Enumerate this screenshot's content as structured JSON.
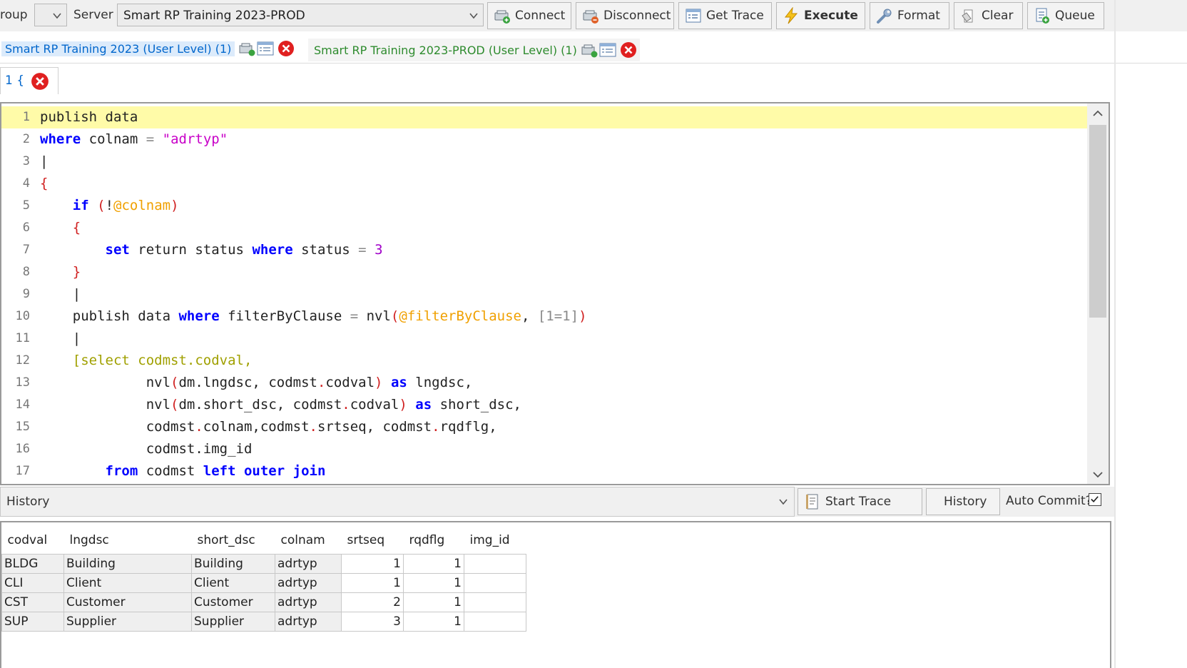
{
  "toolbar": {
    "group_label": "roup",
    "server_label": "Server",
    "server_value": "Smart RP Training 2023-PROD",
    "buttons": {
      "connect": "Connect",
      "disconnect": "Disconnect",
      "get_trace": "Get Trace",
      "execute": "Execute",
      "format": "Format",
      "clear": "Clear",
      "queue": "Queue"
    }
  },
  "connection_tabs": [
    {
      "label": "Smart RP Training 2023 (User Level) (1)"
    },
    {
      "label": "Smart RP Training 2023-PROD (User Level) (1)"
    }
  ],
  "query_tab": {
    "label": "1 {"
  },
  "editor": {
    "line_numbers": [
      "1",
      "2",
      "3",
      "4",
      "5",
      "6",
      "7",
      "8",
      "9",
      "10",
      "11",
      "12",
      "13",
      "14",
      "15",
      "16",
      "17"
    ],
    "current_line": 1,
    "lines": [
      [
        {
          "t": "publish data",
          "c": "plain"
        }
      ],
      [
        {
          "t": "where",
          "c": "kw"
        },
        {
          "t": " colnam ",
          "c": "plain"
        },
        {
          "t": "=",
          "c": "op"
        },
        {
          "t": " ",
          "c": "plain"
        },
        {
          "t": "\"adrtyp\"",
          "c": "str"
        }
      ],
      [
        {
          "t": "|",
          "c": "plain"
        }
      ],
      [
        {
          "t": "{",
          "c": "punc"
        }
      ],
      [
        {
          "t": "    ",
          "c": "plain"
        },
        {
          "t": "if",
          "c": "kw"
        },
        {
          "t": " ",
          "c": "plain"
        },
        {
          "t": "(",
          "c": "punc"
        },
        {
          "t": "!",
          "c": "plain"
        },
        {
          "t": "@colnam",
          "c": "var"
        },
        {
          "t": ")",
          "c": "punc"
        }
      ],
      [
        {
          "t": "    ",
          "c": "plain"
        },
        {
          "t": "{",
          "c": "punc"
        }
      ],
      [
        {
          "t": "        ",
          "c": "plain"
        },
        {
          "t": "set",
          "c": "kw"
        },
        {
          "t": " return status ",
          "c": "plain"
        },
        {
          "t": "where",
          "c": "kw"
        },
        {
          "t": " status ",
          "c": "plain"
        },
        {
          "t": "=",
          "c": "op"
        },
        {
          "t": " ",
          "c": "plain"
        },
        {
          "t": "3",
          "c": "num"
        }
      ],
      [
        {
          "t": "    ",
          "c": "plain"
        },
        {
          "t": "}",
          "c": "punc"
        }
      ],
      [
        {
          "t": "    |",
          "c": "plain"
        }
      ],
      [
        {
          "t": "    publish data ",
          "c": "plain"
        },
        {
          "t": "where",
          "c": "kw"
        },
        {
          "t": " filterByClause ",
          "c": "plain"
        },
        {
          "t": "=",
          "c": "op"
        },
        {
          "t": " nvl",
          "c": "plain"
        },
        {
          "t": "(",
          "c": "punc"
        },
        {
          "t": "@filterByClause",
          "c": "var"
        },
        {
          "t": ",",
          "c": "plain"
        },
        {
          "t": " [1=1]",
          "c": "gray"
        },
        {
          "t": ")",
          "c": "punc"
        }
      ],
      [
        {
          "t": "    |",
          "c": "plain"
        }
      ],
      [
        {
          "t": "    ",
          "c": "plain"
        },
        {
          "t": "[select codmst.codval,",
          "c": "sq"
        }
      ],
      [
        {
          "t": "             nvl",
          "c": "plain"
        },
        {
          "t": "(",
          "c": "punc"
        },
        {
          "t": "dm.lngdsc, codmst",
          "c": "plain"
        },
        {
          "t": ".",
          "c": "punc"
        },
        {
          "t": "codval",
          "c": "plain"
        },
        {
          "t": ")",
          "c": "punc"
        },
        {
          "t": " ",
          "c": "plain"
        },
        {
          "t": "as",
          "c": "kw"
        },
        {
          "t": " lngdsc,",
          "c": "plain"
        }
      ],
      [
        {
          "t": "             nvl",
          "c": "plain"
        },
        {
          "t": "(",
          "c": "punc"
        },
        {
          "t": "dm.short_dsc, codmst",
          "c": "plain"
        },
        {
          "t": ".",
          "c": "punc"
        },
        {
          "t": "codval",
          "c": "plain"
        },
        {
          "t": ")",
          "c": "punc"
        },
        {
          "t": " ",
          "c": "plain"
        },
        {
          "t": "as",
          "c": "kw"
        },
        {
          "t": " short_dsc,",
          "c": "plain"
        }
      ],
      [
        {
          "t": "             codmst",
          "c": "plain"
        },
        {
          "t": ".",
          "c": "punc"
        },
        {
          "t": "colnam,codmst",
          "c": "plain"
        },
        {
          "t": ".",
          "c": "punc"
        },
        {
          "t": "srtseq, codmst",
          "c": "plain"
        },
        {
          "t": ".",
          "c": "punc"
        },
        {
          "t": "rqdflg,",
          "c": "plain"
        }
      ],
      [
        {
          "t": "             codmst.img_id",
          "c": "plain"
        }
      ],
      [
        {
          "t": "        ",
          "c": "plain"
        },
        {
          "t": "from",
          "c": "kw"
        },
        {
          "t": " codmst ",
          "c": "plain"
        },
        {
          "t": "left outer join",
          "c": "kw"
        }
      ]
    ]
  },
  "history_bar": {
    "combo_value": "History",
    "start_trace": "Start Trace",
    "history_button": "History",
    "auto_commit_label": "Auto Commit?",
    "auto_commit_checked": true
  },
  "results": {
    "columns": [
      "codval",
      "lngdsc",
      "short_dsc",
      "colnam",
      "srtseq",
      "rqdflg",
      "img_id"
    ],
    "rows": [
      [
        "BLDG",
        "Building",
        "Building",
        "adrtyp",
        "1",
        "1",
        ""
      ],
      [
        "CLI",
        "Client",
        "Client",
        "adrtyp",
        "1",
        "1",
        ""
      ],
      [
        "CST",
        "Customer",
        "Customer",
        "adrtyp",
        "2",
        "1",
        ""
      ],
      [
        "SUP",
        "Supplier",
        "Supplier",
        "adrtyp",
        "3",
        "1",
        ""
      ]
    ]
  },
  "colors": {
    "keyword": "#0000ff",
    "string": "#c800c8",
    "variable": "#f0a000",
    "current_line": "#fffba8",
    "active_tab_text": "#0066cc",
    "inactive_tab_text": "#2e8b2e"
  }
}
